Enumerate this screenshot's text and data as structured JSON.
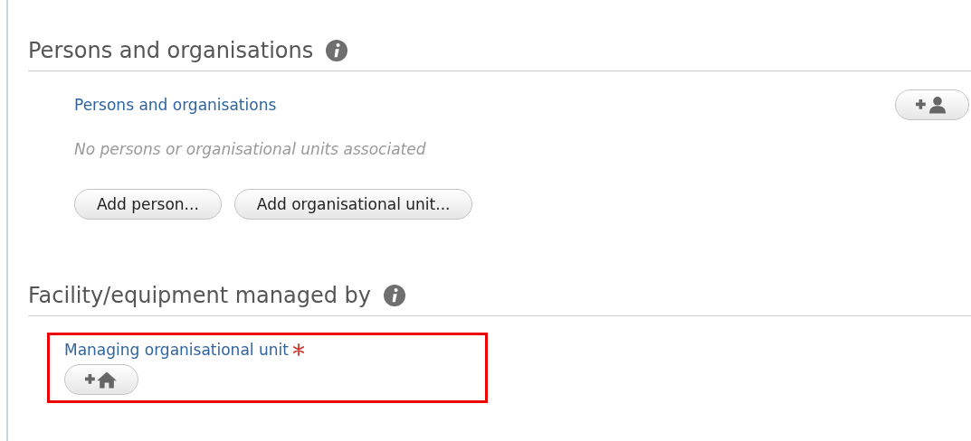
{
  "sections": [
    {
      "title": "Persons and organisations",
      "fields": [
        {
          "kind": "list",
          "label": "Persons and organisations",
          "required": false,
          "highlighted": false,
          "empty_text": "No persons or organisational units associated",
          "icon_button": {
            "kind": "person"
          },
          "buttons": [
            "Add person...",
            "Add organisational unit..."
          ]
        }
      ]
    },
    {
      "title": "Facility/equipment managed by",
      "fields": [
        {
          "kind": "single",
          "label": "Managing organisational unit",
          "required": true,
          "highlighted": true,
          "icon_button": {
            "kind": "home"
          }
        }
      ]
    }
  ]
}
